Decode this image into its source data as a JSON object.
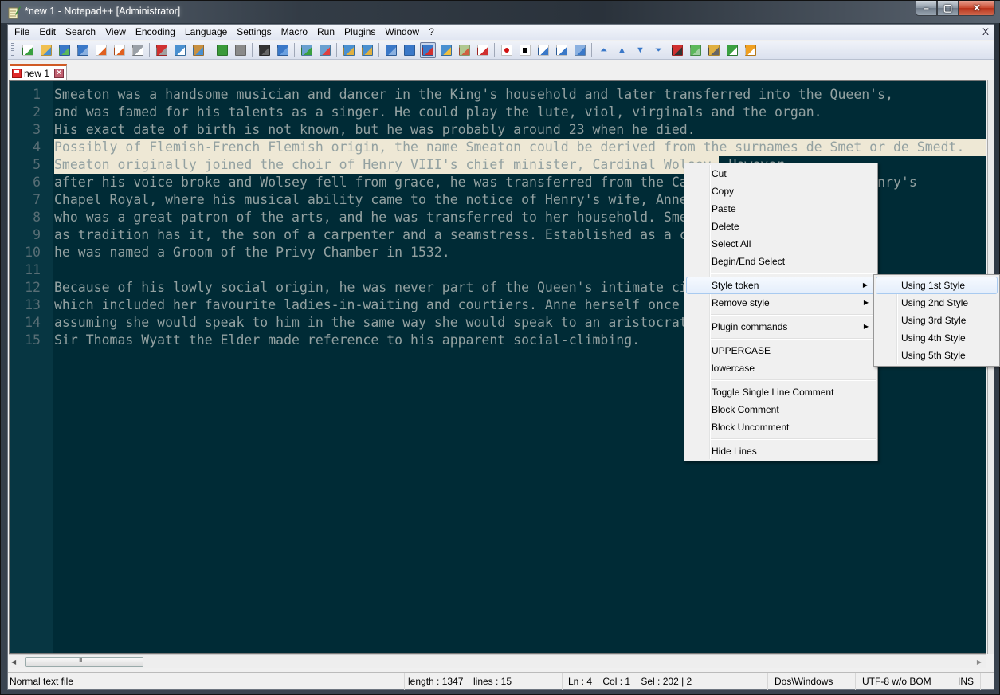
{
  "window": {
    "title": "*new  1 - Notepad++ [Administrator]",
    "minimize_label": "–",
    "maximize_label": "▢",
    "close_label": "✕"
  },
  "menubar": {
    "items": [
      "File",
      "Edit",
      "Search",
      "View",
      "Encoding",
      "Language",
      "Settings",
      "Macro",
      "Run",
      "Plugins",
      "Window",
      "?"
    ],
    "close_doc_label": "X"
  },
  "toolbar": {
    "buttons": [
      {
        "name": "new-file",
        "color": "#ffffff",
        "accent": "#3aa040"
      },
      {
        "name": "open-file",
        "color": "#f0c050",
        "accent": "#4a90d0"
      },
      {
        "name": "save",
        "color": "#3a78c8",
        "accent": "#5cb85c"
      },
      {
        "name": "save-all",
        "color": "#3a78c8",
        "accent": "#8ab0e0"
      },
      {
        "name": "close",
        "color": "#ffffff",
        "accent": "#e06020"
      },
      {
        "name": "close-all",
        "color": "#ffffff",
        "accent": "#e06020"
      },
      {
        "name": "print",
        "color": "#9aa0a8",
        "accent": "#ffffff"
      },
      "sep",
      {
        "name": "cut",
        "color": "#d03030",
        "accent": "#a0a0a0"
      },
      {
        "name": "copy",
        "color": "#4a90d0",
        "accent": "#ffffff"
      },
      {
        "name": "paste",
        "color": "#c89040",
        "accent": "#4a90d0"
      },
      "sep",
      {
        "name": "undo",
        "color": "#3a9a3a",
        "accent": "#3a9a3a"
      },
      {
        "name": "redo",
        "color": "#8a8a8a",
        "accent": "#8a8a8a"
      },
      "sep",
      {
        "name": "find",
        "color": "#333333",
        "accent": "#666666"
      },
      {
        "name": "replace",
        "color": "#3a78c8",
        "accent": "#6aa0e0"
      },
      "sep",
      {
        "name": "zoom-in",
        "color": "#6aa0d0",
        "accent": "#3aa040"
      },
      {
        "name": "zoom-out",
        "color": "#6aa0d0",
        "accent": "#e04040"
      },
      "sep",
      {
        "name": "sync-vertical",
        "color": "#4a90d0",
        "accent": "#e0b040"
      },
      {
        "name": "sync-horizontal",
        "color": "#4a90d0",
        "accent": "#e0b040"
      },
      "sep",
      {
        "name": "word-wrap",
        "color": "#3a78c8",
        "accent": "#8ab0e0"
      },
      {
        "name": "show-all-chars",
        "color": "#3a78c8",
        "accent": "#3a78c8"
      },
      {
        "name": "indent-guide",
        "color": "#3a78c8",
        "accent": "#d03030",
        "active": true
      },
      {
        "name": "define-language",
        "color": "#4a90d0",
        "accent": "#f0c040"
      },
      {
        "name": "document-map",
        "color": "#b0c890",
        "accent": "#d06040"
      },
      {
        "name": "function-list",
        "color": "#ffffff",
        "accent": "#d03030"
      },
      "sep",
      {
        "name": "start-recording",
        "color": "#ffffff",
        "accent": "#d01010"
      },
      {
        "name": "stop-recording",
        "color": "#ffffff",
        "accent": "#000000"
      },
      {
        "name": "playback",
        "color": "#ffffff",
        "accent": "#3a78c8"
      },
      {
        "name": "run-macro-multiple",
        "color": "#ffffff",
        "accent": "#3a78c8"
      },
      {
        "name": "save-macro",
        "color": "#8ab0e0",
        "accent": "#3a78c8"
      },
      "sep",
      {
        "name": "first",
        "color": "#3a78c8",
        "accent": "#3a78c8"
      },
      {
        "name": "previous",
        "color": "#3a78c8",
        "accent": "#3a78c8"
      },
      {
        "name": "next",
        "color": "#3a78c8",
        "accent": "#3a78c8"
      },
      {
        "name": "last",
        "color": "#3a78c8",
        "accent": "#3a78c8"
      },
      {
        "name": "spell-check",
        "color": "#d03030",
        "accent": "#333333"
      },
      {
        "name": "plugin-grid",
        "color": "#5cb85c",
        "accent": "#a0d0a0"
      },
      {
        "name": "folder-plugin",
        "color": "#e0b040",
        "accent": "#666666"
      },
      {
        "name": "add-plugin",
        "color": "#3aa040",
        "accent": "#ffffff"
      },
      {
        "name": "key-plugin",
        "color": "#f0a020",
        "accent": "#ffffff"
      }
    ]
  },
  "tab": {
    "label": "new  1",
    "close_label": "×"
  },
  "editor": {
    "lines": [
      "Smeaton was a handsome musician and dancer in the King's household and later transferred into the Queen's,",
      "and was famed for his talents as a singer. He could play the lute, viol, virginals and the organ.",
      "His exact date of birth is not known, but he was probably around 23 when he died.",
      "Possibly of Flemish-French Flemish origin, the name Smeaton could be derived from the surnames de Smet or de Smedt.",
      "Smeaton originally joined the choir of Henry VIII's chief minister, Cardinal Wolsey. However",
      "after his voice broke and Wolsey fell from grace, he was transferred from the Cardinal's household to Henry's",
      "Chapel Royal, where his musical ability came to the notice of Henry's wife, Anne",
      "who was a great patron of the arts, and he was transferred to her household. Sme",
      "as tradition has it, the son of a carpenter and a seamstress. Established as a c",
      "he was named a Groom of the Privy Chamber in 1532.",
      "",
      "Because of his lowly social origin, he was never part of the Queen's intimate ci",
      "which included her favourite ladies-in-waiting and courtiers. Anne herself once",
      "assuming she would speak to him in the same way she would speak to an aristocrat",
      "Sir Thomas Wyatt the Elder made reference to his apparent social-climbing."
    ],
    "selected_lines": [
      4,
      5
    ],
    "selected_partial_line5": "Smeaton originally joined the choir of Henry VIII's chief minister, Cardinal Wolsey.",
    "unselected_tail_line5": " However",
    "colors": {
      "background": "#002b36",
      "gutter": "#073642",
      "text": "#93a1a1",
      "line_number": "#586e75",
      "selection": "#eee8d5"
    }
  },
  "context_menu": {
    "items": [
      {
        "label": "Cut"
      },
      {
        "label": "Copy"
      },
      {
        "label": "Paste"
      },
      {
        "label": "Delete"
      },
      {
        "label": "Select All"
      },
      {
        "label": "Begin/End Select"
      },
      "sep",
      {
        "label": "Style token",
        "submenu": true,
        "highlighted": true
      },
      {
        "label": "Remove style",
        "submenu": true
      },
      "sep",
      {
        "label": "Plugin commands",
        "submenu": true
      },
      "sep",
      {
        "label": "UPPERCASE"
      },
      {
        "label": "lowercase"
      },
      "sep",
      {
        "label": "Toggle Single Line Comment"
      },
      {
        "label": "Block Comment"
      },
      {
        "label": "Block Uncomment"
      },
      "sep",
      {
        "label": "Hide Lines"
      }
    ],
    "submenu_arrow": "▶"
  },
  "submenu": {
    "items": [
      {
        "label": "Using 1st Style",
        "highlighted": true
      },
      {
        "label": "Using 2nd Style"
      },
      {
        "label": "Using 3rd Style"
      },
      {
        "label": "Using 4th Style"
      },
      {
        "label": "Using 5th Style"
      }
    ]
  },
  "statusbar": {
    "file_type": "Normal text file",
    "length": "length : 1347",
    "lines": "lines : 15",
    "position": "Ln : 4    Col : 1    Sel : 202 | 2",
    "eol": "Dos\\Windows",
    "encoding": "UTF-8 w/o BOM",
    "mode": "INS"
  },
  "scrollbar": {
    "left_arrow": "◀",
    "right_arrow": "▶"
  }
}
